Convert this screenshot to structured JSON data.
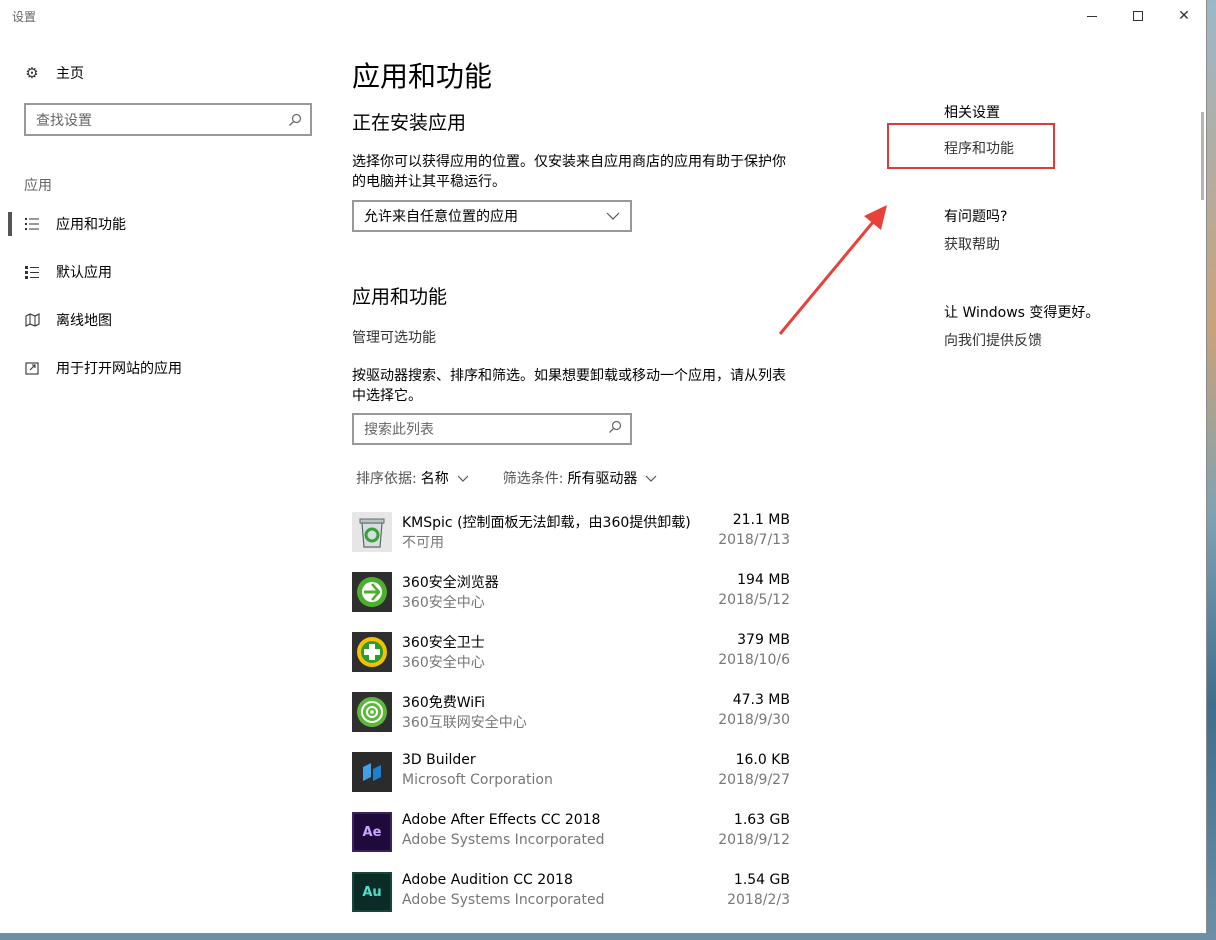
{
  "window": {
    "title": "设置",
    "controls": {
      "minimize": "—",
      "maximize": "□",
      "close": "✕"
    }
  },
  "sidebar": {
    "home_label": "主页",
    "home_icon": "gear-icon",
    "search_placeholder": "查找设置",
    "section_label": "应用",
    "items": [
      {
        "label": "应用和功能",
        "icon": "list-icon",
        "active": true
      },
      {
        "label": "默认应用",
        "icon": "default-apps-icon",
        "active": false
      },
      {
        "label": "离线地图",
        "icon": "map-icon",
        "active": false
      },
      {
        "label": "用于打开网站的应用",
        "icon": "web-app-icon",
        "active": false
      }
    ]
  },
  "main": {
    "page_title": "应用和功能",
    "installing": {
      "heading": "正在安装应用",
      "description": "选择你可以获得应用的位置。仅安装来自应用商店的应用有助于保护你的电脑并让其平稳运行。",
      "dropdown_value": "允许来自任意位置的应用"
    },
    "apps": {
      "heading": "应用和功能",
      "manage_optional": "管理可选功能",
      "description": "按驱动器搜索、排序和筛选。如果想要卸载或移动一个应用，请从列表中选择它。",
      "search_placeholder": "搜索此列表",
      "sort_label": "排序依据:",
      "sort_value": "名称",
      "filter_label": "筛选条件:",
      "filter_value": "所有驱动器",
      "list": [
        {
          "name": " KMSpic (控制面板无法卸载，由360提供卸载)",
          "publisher": "不可用",
          "size": "21.1 MB",
          "date": "2018/7/13",
          "icon": "recycle-bin-icon",
          "color": "#6a8a6a"
        },
        {
          "name": "360安全浏览器",
          "publisher": "360安全中心",
          "size": "194 MB",
          "date": "2018/5/12",
          "icon": "browser-360-icon",
          "color": "#3aa03a"
        },
        {
          "name": "360安全卫士",
          "publisher": "360安全中心",
          "size": "379 MB",
          "date": "2018/10/6",
          "icon": "guard-360-icon",
          "color": "#2d9b2d"
        },
        {
          "name": "360免费WiFi",
          "publisher": "360互联网安全中心",
          "size": "47.3 MB",
          "date": "2018/9/30",
          "icon": "wifi-360-icon",
          "color": "#4cae3a"
        },
        {
          "name": "3D Builder",
          "publisher": "Microsoft Corporation",
          "size": "16.0 KB",
          "date": "2018/9/27",
          "icon": "3d-builder-icon",
          "color": "#2b2b2b"
        },
        {
          "name": "Adobe After Effects CC 2018",
          "publisher": "Adobe Systems Incorporated",
          "size": "1.63 GB",
          "date": "2018/9/12",
          "icon": "after-effects-icon",
          "color": "#1f0b3b",
          "abbr": "Ae"
        },
        {
          "name": "Adobe Audition CC 2018",
          "publisher": "Adobe Systems Incorporated",
          "size": "1.54 GB",
          "date": "2018/2/3",
          "icon": "audition-icon",
          "color": "#0b2b27",
          "abbr": "Au"
        }
      ]
    }
  },
  "right": {
    "related_heading": "相关设置",
    "programs_link": "程序和功能",
    "question_heading": "有问题吗?",
    "help_link": "获取帮助",
    "better_heading": "让 Windows 变得更好。",
    "feedback_link": "向我们提供反馈",
    "highlight_color": "#e0393a"
  }
}
